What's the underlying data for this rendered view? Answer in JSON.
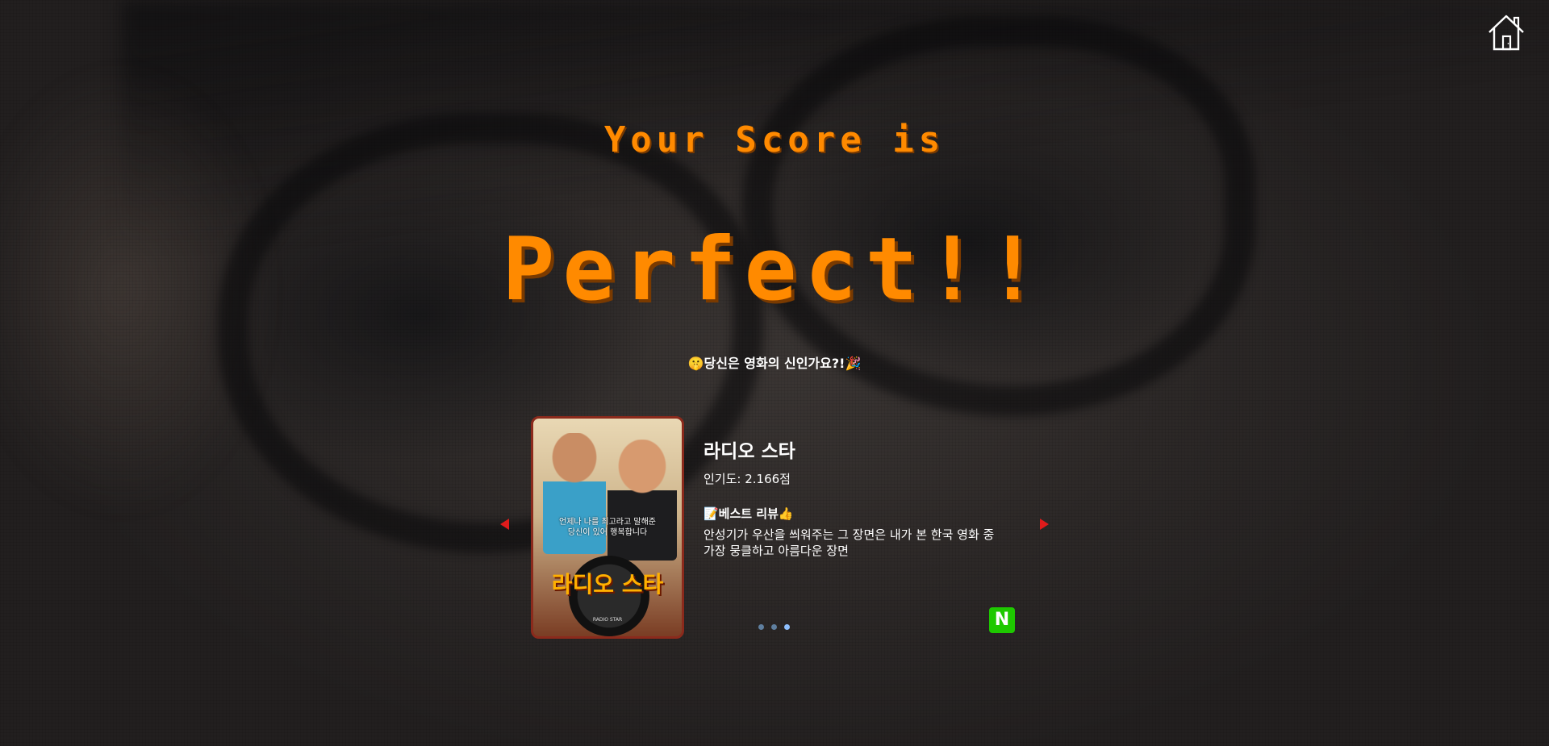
{
  "header": {
    "home_icon": "home-icon"
  },
  "result": {
    "score_label": "Your Score is",
    "score_value": "Perfect!!",
    "tagline": "🤫당신은 영화의 신인가요?!🎉"
  },
  "carousel": {
    "prev_icon": "triangle-left-icon",
    "next_icon": "triangle-right-icon",
    "slides_count": 3,
    "active_index": 2,
    "slide": {
      "poster": {
        "caption_line1": "언제나 나를 최고라고 말해준",
        "caption_line2": "당신이 있어 행복합니다",
        "title": "라디오 스타",
        "subtitle": "RADIO STAR"
      },
      "title": "라디오 스타",
      "popularity": "인기도: 2.166점",
      "review_head": "📝베스트 리뷰👍",
      "review_text": "안성기가 우산을 씌워주는 그 장면은 내가 본 한국 영화 중 가장 뭉클하고 아름다운 장면",
      "source_badge": "N"
    }
  },
  "colors": {
    "score": "#ff8a00",
    "arrow": "#e01b1b",
    "naver": "#1ec800",
    "dot": "#5f7f9f",
    "dot_active": "#8fc0ff"
  }
}
